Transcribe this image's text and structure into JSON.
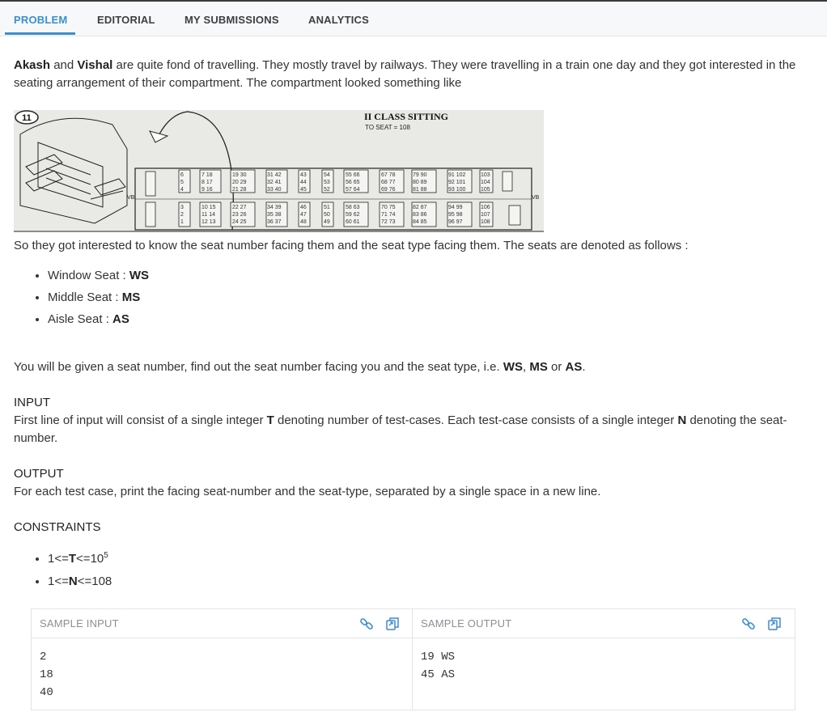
{
  "tabs": [
    {
      "label": "PROBLEM",
      "active": true
    },
    {
      "label": "EDITORIAL",
      "active": false
    },
    {
      "label": "MY SUBMISSIONS",
      "active": false
    },
    {
      "label": "ANALYTICS",
      "active": false
    }
  ],
  "intro": {
    "name1": "Akash",
    "and": " and ",
    "name2": "Vishal",
    "text": " are quite fond of travelling. They mostly travel by railways. They were travelling in a train one day and they got interested in the seating arrangement of their compartment. The compartment looked something like"
  },
  "figure": {
    "badge": "11",
    "title": "II CLASS SITTING",
    "subtitle": "TO SEAT = 108",
    "vb_left": "VB",
    "vb_right": "VB"
  },
  "para2": "So they got interested to know the seat number facing them and the seat type facing them. The seats are denoted as follows :",
  "seat_types": [
    {
      "label": "Window Seat : ",
      "code": "WS"
    },
    {
      "label": "Middle Seat : ",
      "code": "MS"
    },
    {
      "label": "Aisle Seat : ",
      "code": "AS"
    }
  ],
  "task": {
    "pre": "You will be given a seat number, find out the seat number facing you and the seat type, i.e. ",
    "c1": "WS",
    "sep1": ", ",
    "c2": "MS",
    "sep2": " or ",
    "c3": "AS",
    "post": "."
  },
  "input": {
    "heading": "INPUT",
    "t1": "First line of input will consist of a single integer ",
    "v1": "T",
    "t2": " denoting number of test-cases. Each test-case consists of a single integer ",
    "v2": "N",
    "t3": " denoting the seat-number."
  },
  "output": {
    "heading": "OUTPUT",
    "text": "For each test case, print the facing seat-number and the seat-type, separated by a single space in a new line."
  },
  "constraints": {
    "heading": "CONSTRAINTS",
    "c1_pre": "1<=",
    "c1_var": "T",
    "c1_post": "<=10",
    "c1_exp": "5",
    "c2_pre": "1<=",
    "c2_var": "N",
    "c2_post": "<=108"
  },
  "sample": {
    "input_title": "SAMPLE INPUT",
    "output_title": "SAMPLE OUTPUT",
    "input_text": "2\n18\n40",
    "output_text": "19 WS\n45 AS"
  },
  "colors": {
    "accent": "#3a8ed3",
    "text": "#333333",
    "muted": "#8a8f96"
  }
}
